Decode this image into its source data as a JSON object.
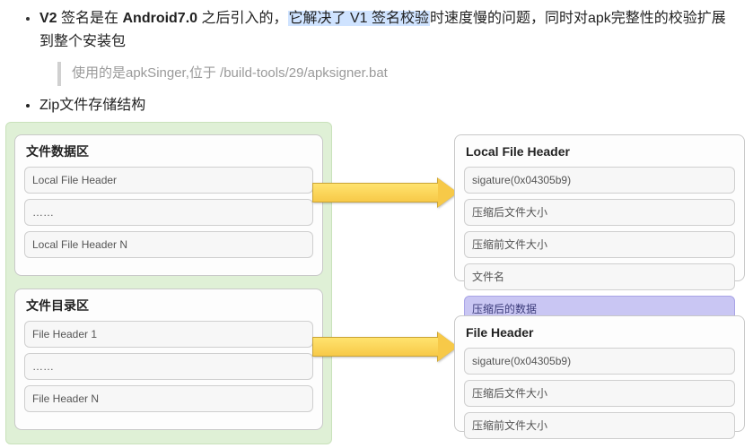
{
  "bullets": {
    "b1_pre": "V2",
    "b1_mid1": " 签名是在 ",
    "b1_bold2": "Android7.0",
    "b1_mid2": " 之后引入的，",
    "b1_hl": "它解决了 V1 签名校验",
    "b1_post": "时速度慢的问题，同时对apk完整性的校验扩展到整个安装包",
    "quote": "使用的是apkSinger,位于 /build-tools/29/apksigner.bat",
    "b2": "Zip文件存储结构"
  },
  "left1": {
    "title": "文件数据区",
    "rows": [
      "Local File Header",
      "……",
      "Local File Header N"
    ]
  },
  "left2": {
    "title": "文件目录区",
    "rows": [
      "File Header  1",
      "……",
      "File Header N"
    ]
  },
  "right1": {
    "title": "Local File Header",
    "rows": [
      "sigature(0x04305b9)",
      "压缩后文件大小",
      "压缩前文件大小",
      "文件名",
      "压缩后的数据"
    ]
  },
  "right2": {
    "title": "File Header",
    "rows": [
      "sigature(0x04305b9)",
      "压缩后文件大小",
      "压缩前文件大小"
    ]
  }
}
